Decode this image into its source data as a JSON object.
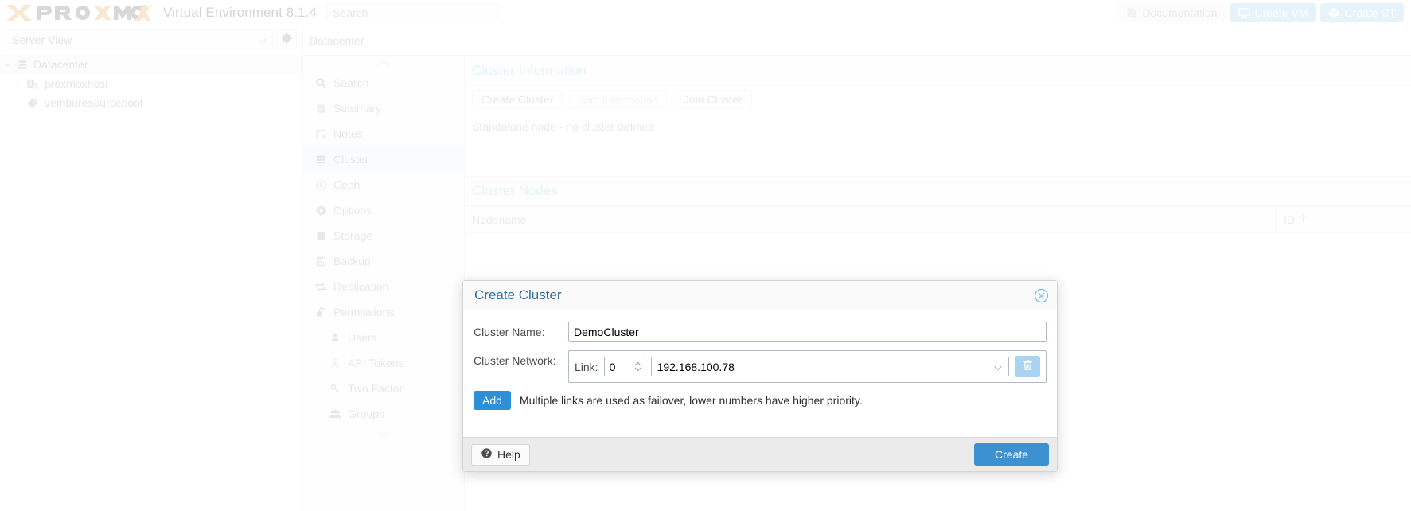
{
  "topbar": {
    "logo_text": "PROXMOX",
    "product_name": "Virtual Environment 8.1.4",
    "search_placeholder": "Search",
    "documentation_label": "Documentation",
    "create_vm_label": "Create VM",
    "create_ct_label": "Create CT",
    "accent": "#e8c38a"
  },
  "treepanel": {
    "view_select_value": "Server View",
    "items": [
      {
        "label": "Datacenter",
        "icon": "datacenter-icon",
        "selected": true,
        "indent": 0,
        "arrow": "down"
      },
      {
        "label": "proxmoxhost",
        "icon": "node-icon",
        "selected": false,
        "indent": 1,
        "arrow": "right"
      },
      {
        "label": "vemburesourcepool",
        "icon": "pool-icon",
        "selected": false,
        "indent": 1,
        "arrow": "none"
      }
    ]
  },
  "breadcrumb": {
    "text": "Datacenter"
  },
  "innernav": {
    "items": [
      {
        "label": "Search",
        "icon": "search-icon",
        "selected": false,
        "sub": false
      },
      {
        "label": "Summary",
        "icon": "summary-icon",
        "selected": false,
        "sub": false
      },
      {
        "label": "Notes",
        "icon": "notes-icon",
        "selected": false,
        "sub": false
      },
      {
        "label": "Cluster",
        "icon": "cluster-icon",
        "selected": true,
        "sub": false
      },
      {
        "label": "Ceph",
        "icon": "ceph-icon",
        "selected": false,
        "sub": false
      },
      {
        "label": "Options",
        "icon": "options-icon",
        "selected": false,
        "sub": false
      },
      {
        "label": "Storage",
        "icon": "storage-icon",
        "selected": false,
        "sub": false
      },
      {
        "label": "Backup",
        "icon": "backup-icon",
        "selected": false,
        "sub": false
      },
      {
        "label": "Replication",
        "icon": "replication-icon",
        "selected": false,
        "sub": false
      },
      {
        "label": "Permissions",
        "icon": "permissions-icon",
        "selected": false,
        "sub": false
      },
      {
        "label": "Users",
        "icon": "user-icon",
        "selected": false,
        "sub": true
      },
      {
        "label": "API Tokens",
        "icon": "api-token-icon",
        "selected": false,
        "sub": true
      },
      {
        "label": "Two Factor",
        "icon": "key-icon",
        "selected": false,
        "sub": true
      },
      {
        "label": "Groups",
        "icon": "groups-icon",
        "selected": false,
        "sub": true
      }
    ]
  },
  "cluster_information": {
    "title": "Cluster Information",
    "buttons": [
      {
        "label": "Create Cluster",
        "disabled": false
      },
      {
        "label": "Join Information",
        "disabled": true
      },
      {
        "label": "Join Cluster",
        "disabled": false
      }
    ],
    "status_text": "Standalone node - no cluster defined"
  },
  "cluster_nodes": {
    "title": "Cluster Nodes",
    "columns": [
      {
        "label": "Nodename",
        "sort": ""
      },
      {
        "label": "ID",
        "sort": "asc"
      }
    ],
    "rows": []
  },
  "modal": {
    "title": "Create Cluster",
    "close_icon": "close-icon",
    "cluster_name_label": "Cluster Name:",
    "cluster_name_value": "DemoCluster",
    "cluster_network_label": "Cluster Network:",
    "link_label": "Link:",
    "link_value": "0",
    "address_value": "192.168.100.78",
    "delete_icon": "trash-icon",
    "add_label": "Add",
    "hint_text": "Multiple links are used as failover, lower numbers have higher priority.",
    "help_label": "Help",
    "help_icon": "question-icon",
    "create_label": "Create",
    "accent": "#3c91d0"
  }
}
